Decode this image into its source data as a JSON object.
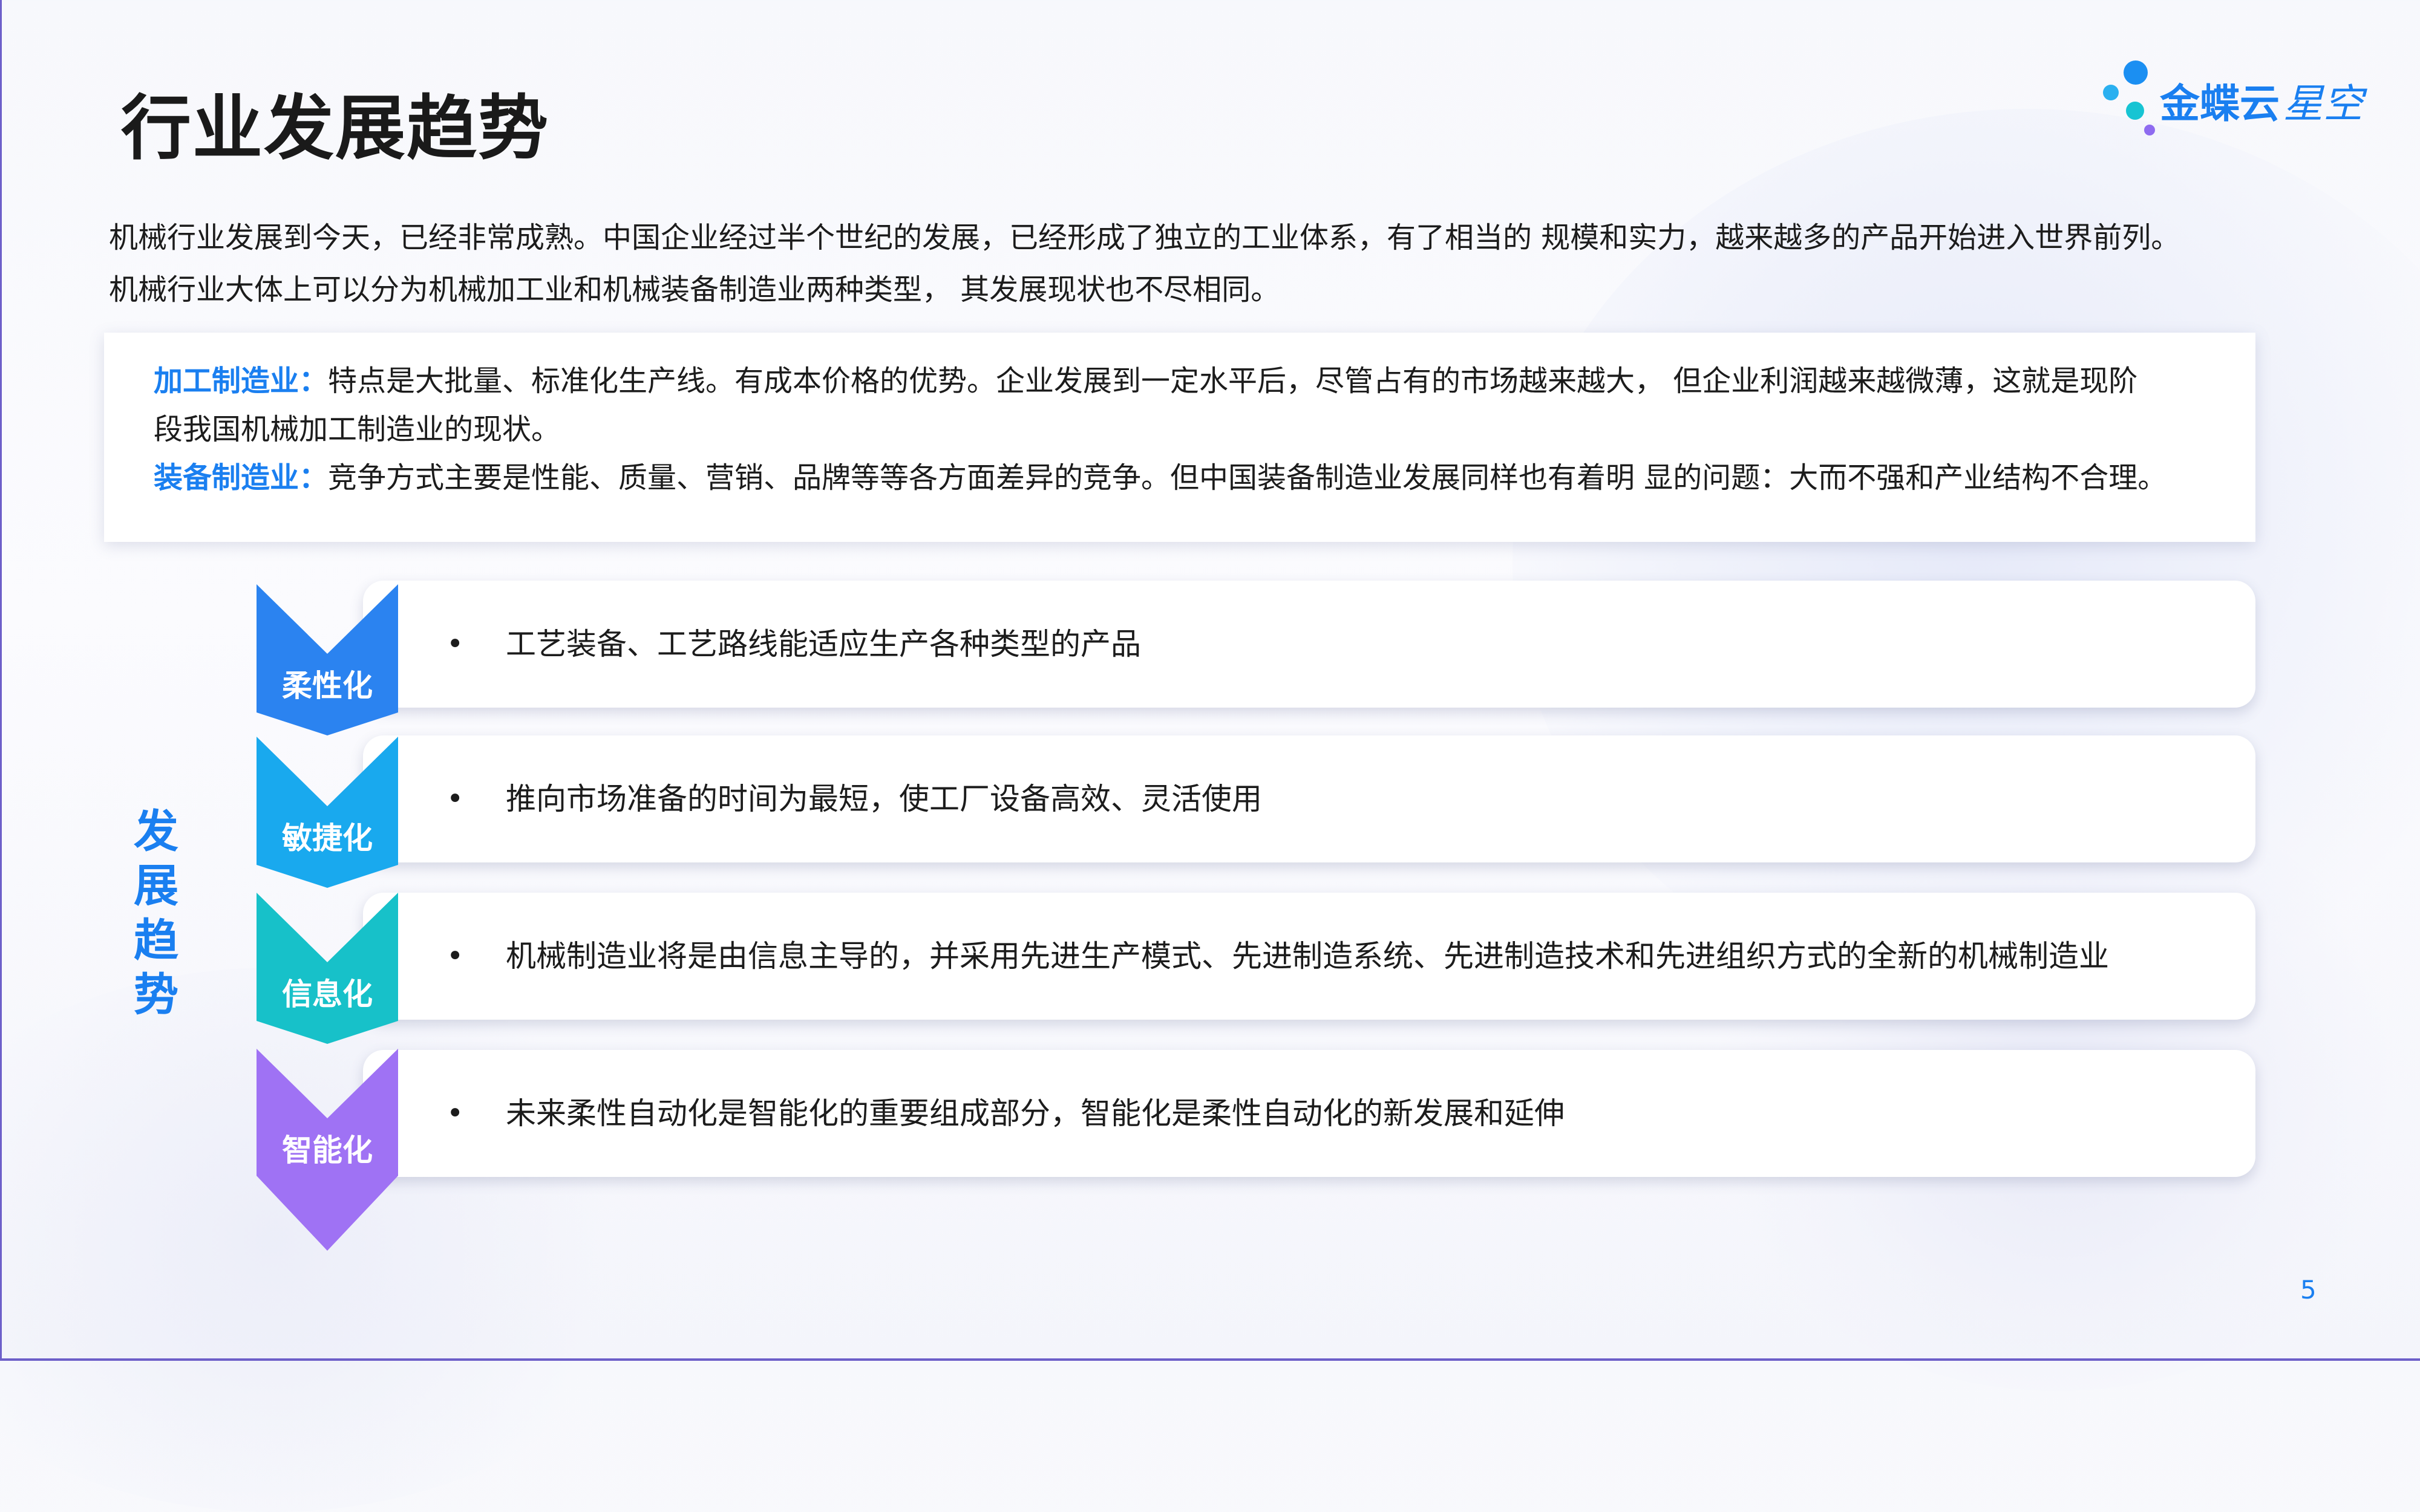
{
  "title": "行业发展趋势",
  "logo": {
    "main": "金蝶云",
    "sub": "星空"
  },
  "intro": [
    "机械行业发展到今天，已经非常成熟。中国企业经过半个世纪的发展，已经形成了独立的工业体系，有了相当的 规模和实力，越来越多的产品开始进入世界前列。",
    "机械行业大体上可以分为机械加工业和机械装备制造业两种类型， 其发展现状也不尽相同。"
  ],
  "box": {
    "item1_key": "加工制造业：",
    "item1_line1": "特点是大批量、标准化生产线。有成本价格的优势。企业发展到一定水平后，尽管占有的市场越来越大， 但企业利润越来越微薄，这就是现阶",
    "item1_line2": "段我国机械加工制造业的现状。",
    "item2_key": "装备制造业：",
    "item2_text": "竞争方式主要是性能、质量、营销、品牌等等各方面差异的竞争。但中国装备制造业发展同样也有着明 显的问题：大而不强和产业结构不合理。"
  },
  "side_title": [
    "发",
    "展",
    "趋",
    "势"
  ],
  "trends": [
    {
      "label": "柔性化",
      "color": "#2b83f0",
      "text": "工艺装备、工艺路线能适应生产各种类型的产品"
    },
    {
      "label": "敏捷化",
      "color": "#19a9ee",
      "text": "推向市场准备的时间为最短，使工厂设备高效、灵活使用"
    },
    {
      "label": "信息化",
      "color": "#17c1c9",
      "text": "机械制造业将是由信息主导的，并采用先进生产模式、先进制造系统、先进制造技术和先进组织方式的全新的机械制造业"
    },
    {
      "label": "智能化",
      "color": "#9f72f4",
      "text": "未来柔性自动化是智能化的重要组成部分，智能化是柔性自动化的新发展和延伸"
    }
  ],
  "bullet": "•",
  "page_number": "5"
}
